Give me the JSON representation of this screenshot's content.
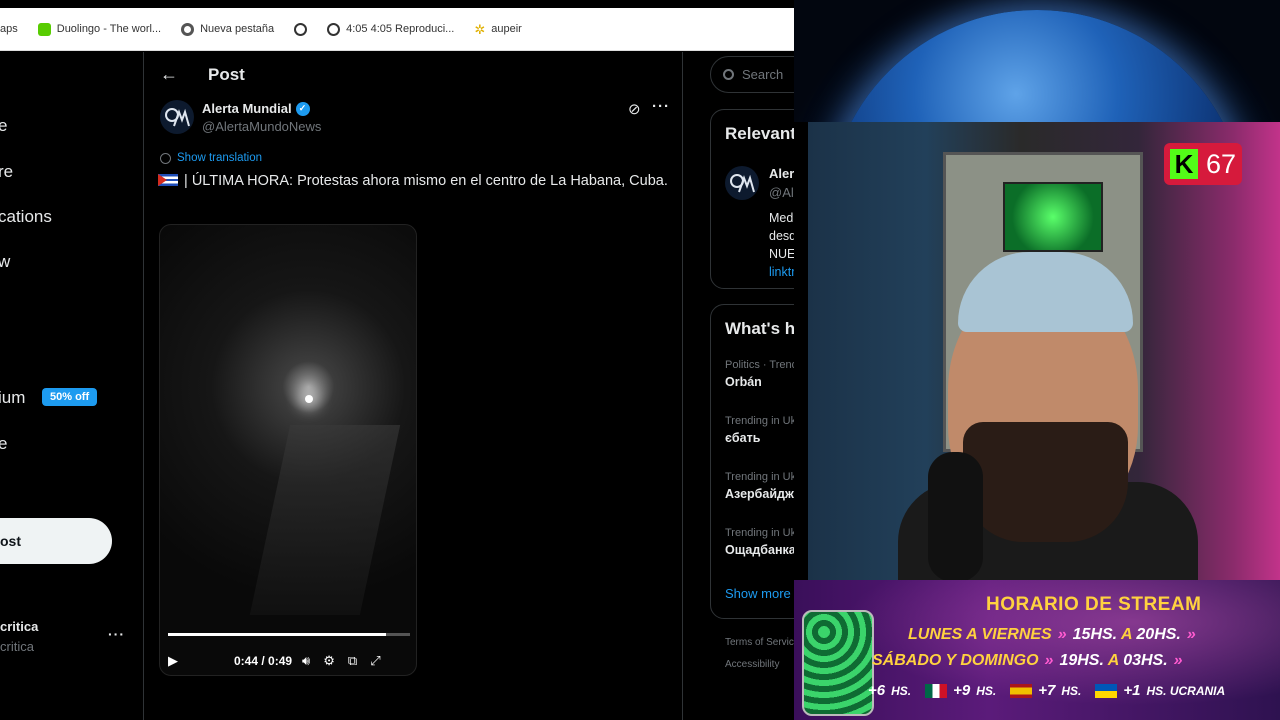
{
  "bookmarks": [
    {
      "label": "aps",
      "icon": "none"
    },
    {
      "label": "Duolingo - The worl...",
      "icon": "duolingo-icon"
    },
    {
      "label": "Nueva pestaña",
      "icon": "chrome-icon"
    },
    {
      "label": "",
      "icon": "globe-icon"
    },
    {
      "label": "4:05 4:05 Reproduci...",
      "icon": "globe-icon"
    },
    {
      "label": "aupeir",
      "icon": "sparkle-icon"
    }
  ],
  "nav": {
    "items": [
      "e",
      "re",
      "cations",
      "w",
      "ium",
      "e"
    ],
    "premium_badge": "50% off",
    "post_button": "ost",
    "account_name": "critica",
    "account_handle": "critica",
    "more": "···"
  },
  "post": {
    "header_title": "Post",
    "back": "←",
    "avatar_text": "A",
    "author_name": "Alerta Mundial",
    "author_handle": "@AlertaMundoNews",
    "show_translation": "Show translation",
    "text": "| ÚLTIMA HORA: Protestas ahora mismo en el centro de La Habana, Cuba.",
    "more": "···"
  },
  "video": {
    "time": "0:44 / 0:49",
    "progress": 0.9
  },
  "right": {
    "search_placeholder": "Search",
    "relevant_title": "Relevant",
    "rel_name": "Alerta",
    "rel_handle": "@Alert",
    "rel_bio": [
      "Medio",
      "desde",
      "NUEST"
    ],
    "rel_link": "linktr.e",
    "happening_title": "What's ha",
    "trends": [
      {
        "category": "Politics · Trendi",
        "name": "Orbán"
      },
      {
        "category": "Trending in Ukra",
        "name": "єбать"
      },
      {
        "category": "Trending in Ukra",
        "name": "Азербайджа"
      },
      {
        "category": "Trending in Ukra",
        "name": "Ощадбанка"
      }
    ],
    "show_more": "Show more",
    "footer": [
      "Terms of Servic",
      "Accessibility"
    ]
  },
  "overlay": {
    "kick_logo": "K",
    "viewer_count": "67",
    "schedule_title": "HORARIO DE STREAM",
    "rows": [
      {
        "days": "LUNES A VIERNES",
        "from": "15HS.",
        "sep": "A",
        "to": "20HS."
      },
      {
        "days": "SÁBADO Y DOMINGO",
        "from": "19HS.",
        "sep": "A",
        "to": "03HS."
      }
    ],
    "timezones": [
      {
        "offset": "+6",
        "unit": "HS."
      },
      {
        "offset": "+9",
        "unit": "HS."
      },
      {
        "offset": "+7",
        "unit": "HS."
      },
      {
        "offset": "+1",
        "unit": "HS. UCRANIA"
      }
    ],
    "edge_char": "1"
  },
  "colors": {
    "accent": "#1d9bf0",
    "kick_green": "#53fc18",
    "schedule_yellow": "#ffd23f"
  }
}
